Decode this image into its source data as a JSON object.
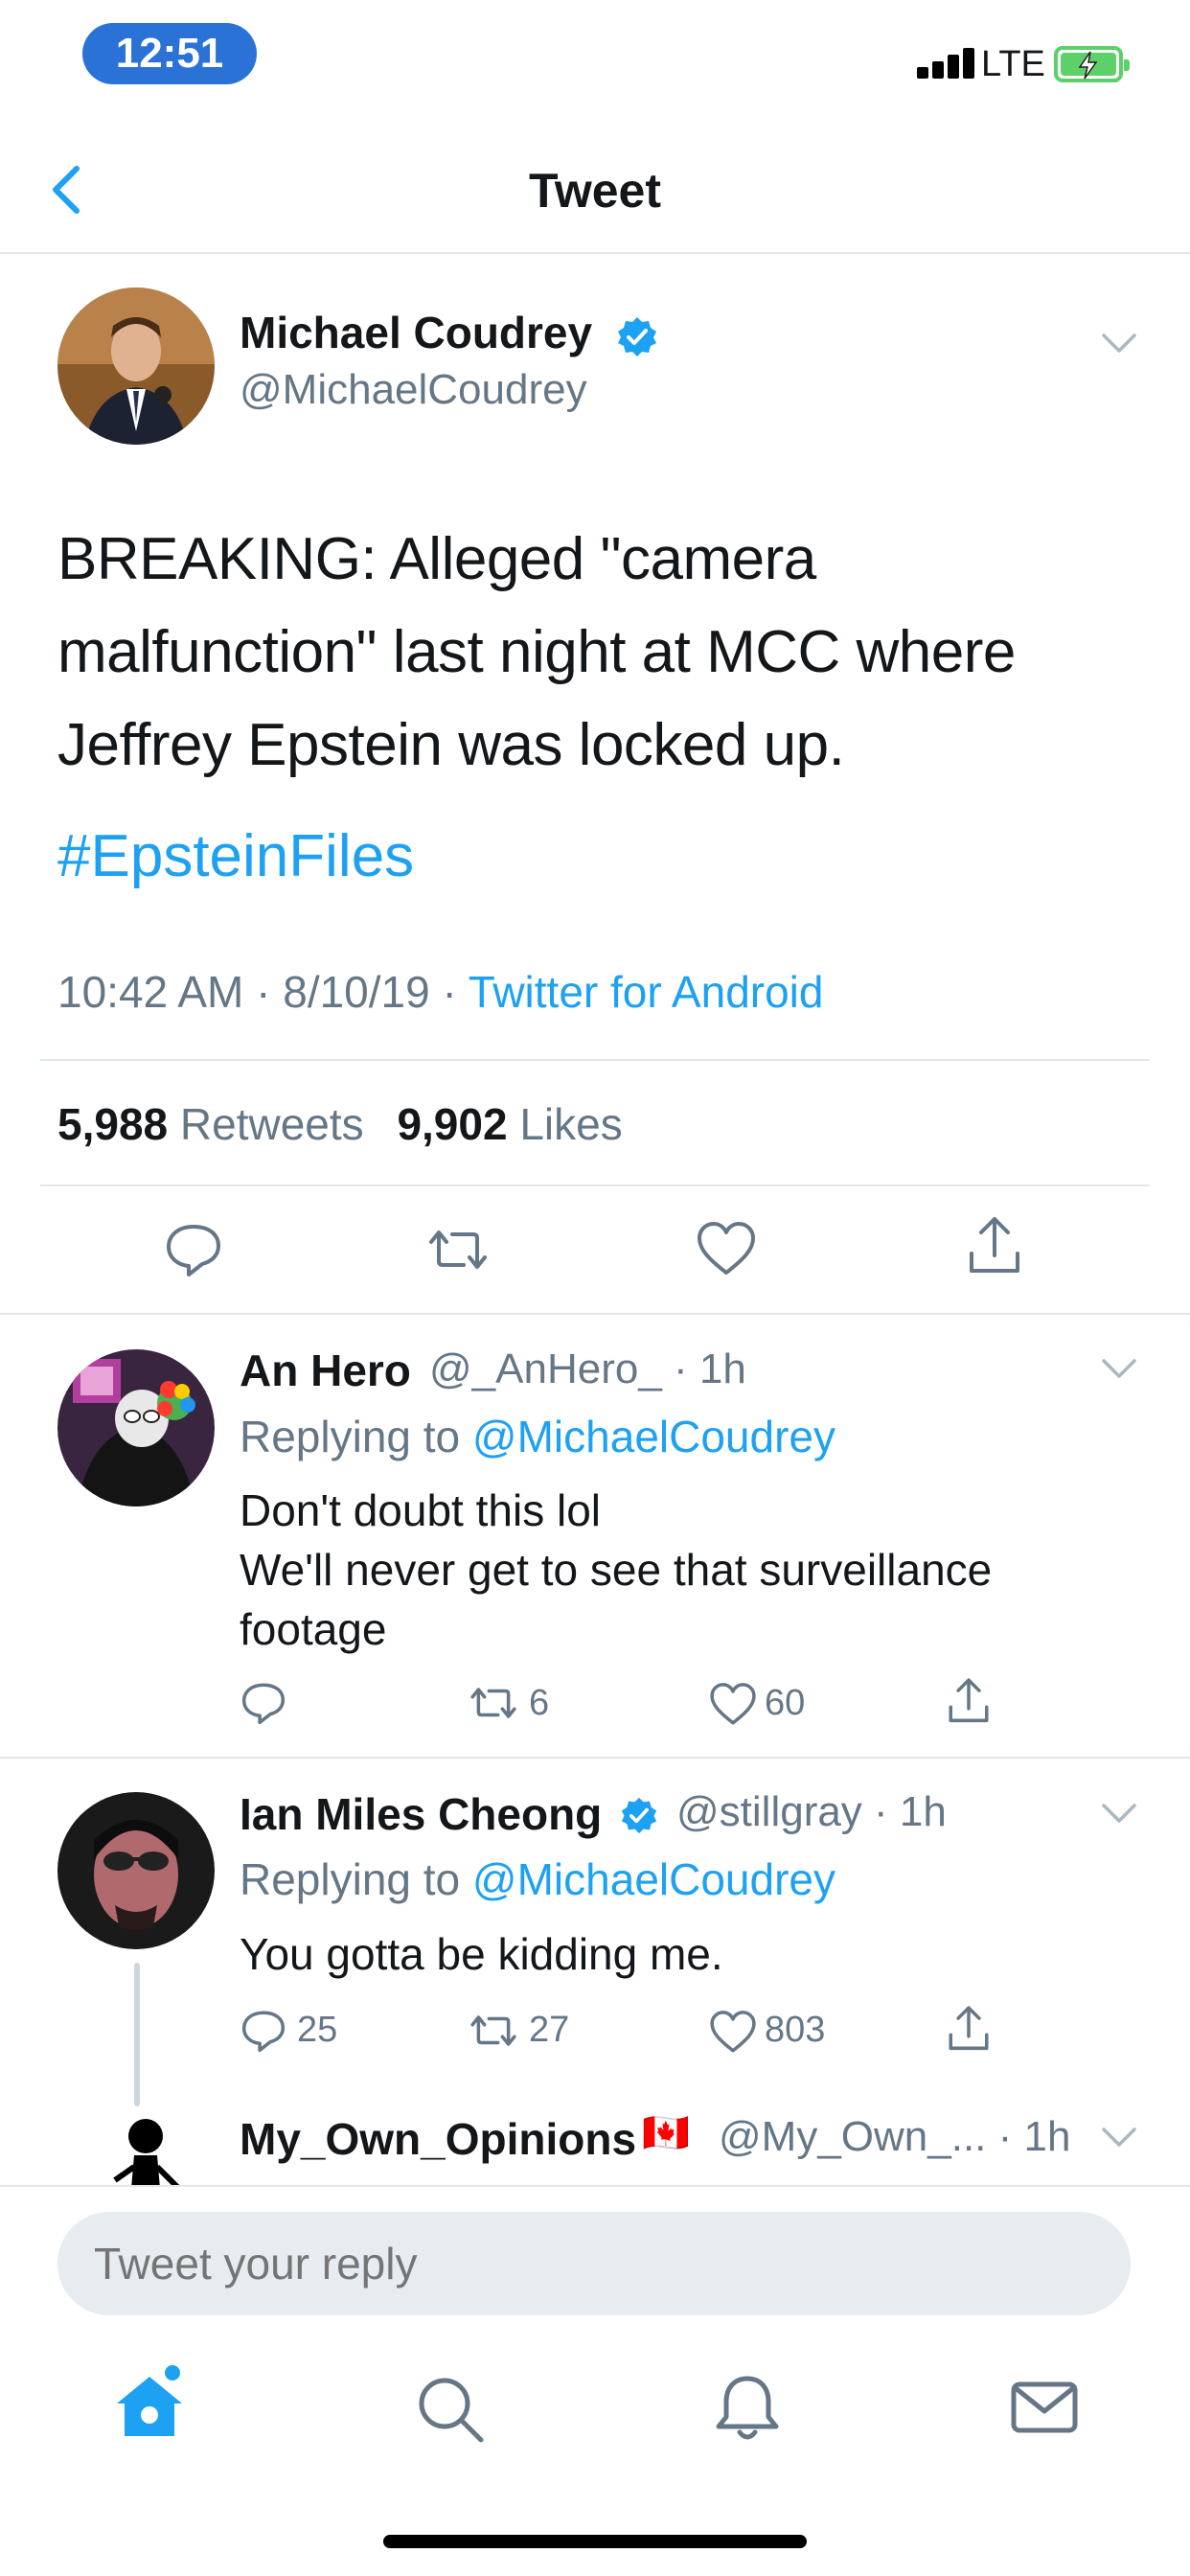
{
  "status_bar": {
    "time": "12:51",
    "network": "LTE"
  },
  "header": {
    "title": "Tweet"
  },
  "main_tweet": {
    "name": "Michael Coudrey",
    "handle": "@MichaelCoudrey",
    "text": "BREAKING: Alleged \"camera malfunction\" last night at MCC where Jeffrey Epstein was locked up.",
    "hashtag": "#EpsteinFiles",
    "time": "10:42 AM · 8/10/19 · ",
    "source": "Twitter for Android",
    "retweets_count": "5,988",
    "retweets_label": "Retweets",
    "likes_count": "9,902",
    "likes_label": "Likes"
  },
  "replies": [
    {
      "name": "An Hero",
      "handle_time": "@_AnHero_ · 1h",
      "replying_to_label": "Replying to ",
      "replying_to": "@MichaelCoudrey",
      "text_lines": [
        "Don't doubt this lol",
        "We'll never get to see that surveillance footage"
      ],
      "replies": "",
      "retweets": "6",
      "likes": "60"
    },
    {
      "name": "Ian Miles Cheong",
      "handle_time": "@stillgray · 1h",
      "replying_to_label": "Replying to ",
      "replying_to": "@MichaelCoudrey",
      "text_lines": [
        "You gotta be kidding me."
      ],
      "replies": "25",
      "retweets": "27",
      "likes": "803"
    },
    {
      "name": "My_Own_Opinions",
      "flag": "🇨🇦",
      "handle_time": "@My_Own_... · 1h"
    }
  ],
  "reply_bar": {
    "placeholder": "Tweet your reply"
  },
  "colors": {
    "accent": "#1da1f2",
    "secondary_text": "#657786",
    "status_pill": "#2a72d5"
  },
  "icons": [
    "back-chevron-icon",
    "verified-badge-icon",
    "reply-icon",
    "retweet-icon",
    "like-icon",
    "share-icon",
    "home-icon",
    "search-icon",
    "bell-icon",
    "mail-icon"
  ]
}
